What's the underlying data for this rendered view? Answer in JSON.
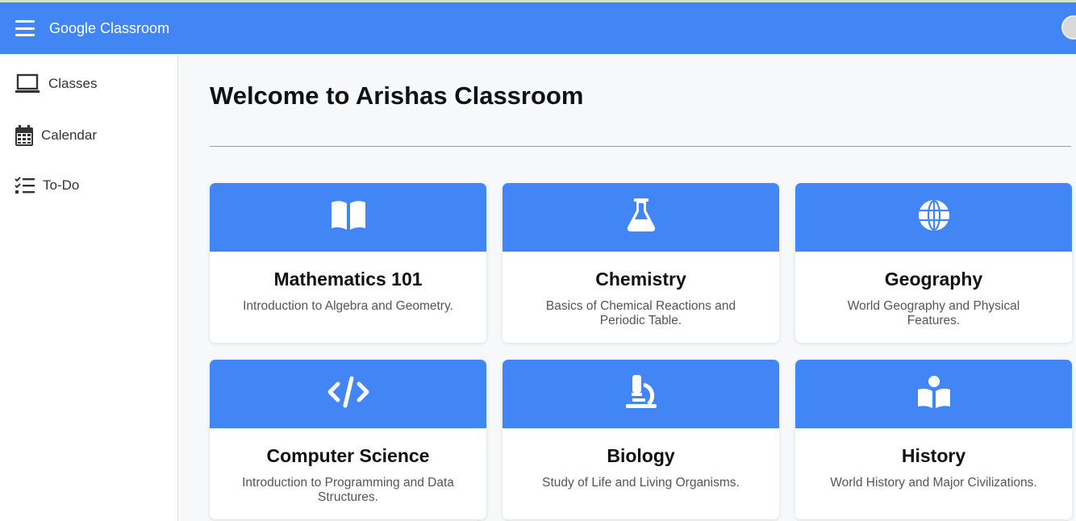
{
  "appbar": {
    "title": "Google Classroom",
    "menu_icon": "hamburger-menu-icon"
  },
  "sidebar": {
    "items": [
      {
        "label": "Classes",
        "icon": "laptop-icon"
      },
      {
        "label": "Calendar",
        "icon": "calendar-icon"
      },
      {
        "label": "To-Do",
        "icon": "checklist-icon"
      }
    ]
  },
  "main": {
    "welcome": "Welcome to Arishas Classroom",
    "cards": [
      {
        "title": "Mathematics 101",
        "desc": "Introduction to Algebra and Geometry.",
        "icon": "book-open-icon"
      },
      {
        "title": "Chemistry",
        "desc": "Basics of Chemical Reactions and Periodic Table.",
        "icon": "flask-icon"
      },
      {
        "title": "Geography",
        "desc": "World Geography and Physical Features.",
        "icon": "globe-icon"
      },
      {
        "title": "Computer Science",
        "desc": "Introduction to Programming and Data Structures.",
        "icon": "code-icon"
      },
      {
        "title": "Biology",
        "desc": "Study of Life and Living Organisms.",
        "icon": "microscope-icon"
      },
      {
        "title": "History",
        "desc": "World History and Major Civilizations.",
        "icon": "book-reader-icon"
      }
    ]
  },
  "colors": {
    "brand": "#4285f4",
    "background": "#f7f8fa"
  }
}
